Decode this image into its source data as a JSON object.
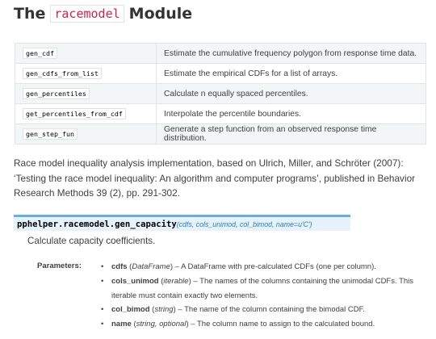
{
  "title": {
    "prefix": "The",
    "module": "racemodel",
    "suffix": "Module"
  },
  "functions": [
    {
      "name": "gen_cdf",
      "desc": "Estimate the cumulative frequency polygon from response time data."
    },
    {
      "name": "gen_cdfs_from_list",
      "desc": "Estimate the empirical CDFs for a list of arrays."
    },
    {
      "name": "gen_percentiles",
      "desc": "Calculate n equally spaced percentiles."
    },
    {
      "name": "get_percentiles_from_cdf",
      "desc": "Interpolate the percentile boundaries."
    },
    {
      "name": "gen_step_fun",
      "desc": "Generate a step function from an observed response time distribution."
    }
  ],
  "intro": "Race model inequality analysis implementation, based on Ulrich, Miller, and Schröter (2007): ‘Testing the race model inequality: An algorithm and computer programs’, published in Behavior Research Methods 39 (2), pp. 291-302.",
  "signature": {
    "name": "pphelper.racemodel.gen_capacity",
    "params": "(cdfs, cols_unimod, col_bimod, name=u'C')"
  },
  "description": "Calculate capacity coefficients.",
  "parameters_label": "Parameters:",
  "parameters": [
    {
      "name": "cdfs",
      "type": "DataFrame",
      "desc": "A DataFrame with pre-calculated CDFs (one per column)."
    },
    {
      "name": "cols_unimod",
      "type": "iterable",
      "desc": "The names of the columns containing the unimodal CDFs. This iterable must contain exactly two elements."
    },
    {
      "name": "col_bimod",
      "type": "string",
      "desc": "The name of the column containing the bimodal CDF."
    },
    {
      "name": "name",
      "type": "string, optional",
      "desc": "The column name to assign to the calculated bound."
    }
  ]
}
